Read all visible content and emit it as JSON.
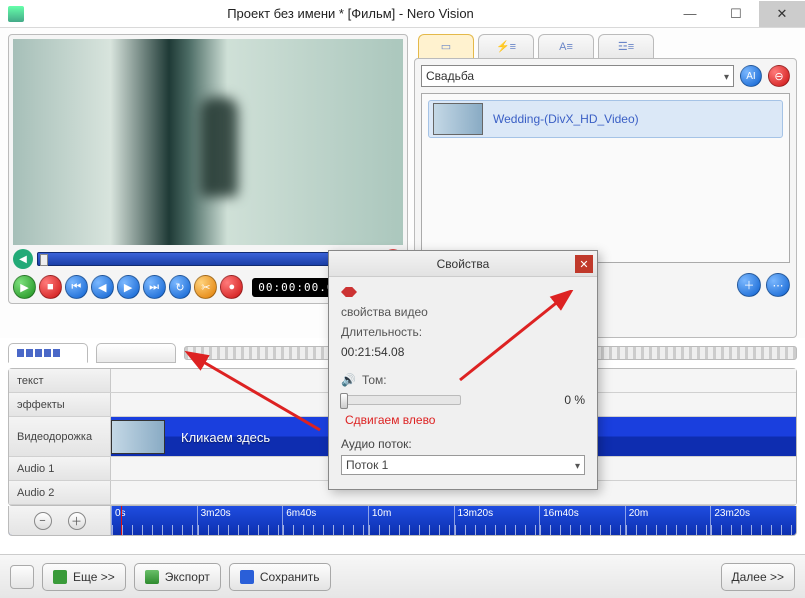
{
  "window": {
    "title": "Проект без имени * [Фильм] - Nero Vision"
  },
  "preview": {
    "timecode": "00:00:00.00"
  },
  "library": {
    "category": "Свадьба",
    "item_name": "Wedding-(DivX_HD_Video)"
  },
  "timeline": {
    "tracks": {
      "text": "текст",
      "effects": "эффекты",
      "video": "Видеодорожка",
      "audio1": "Audio 1",
      "audio2": "Audio 2"
    },
    "clip_label": "Кликаем здесь",
    "ticks": [
      "0s",
      "3m20s",
      "6m40s",
      "10m",
      "13m20s",
      "16m40s",
      "20m",
      "23m20s"
    ]
  },
  "bottom": {
    "more": "Еще >>",
    "export": "Экспорт",
    "save": "Сохранить",
    "next": "Далее >>"
  },
  "props": {
    "title": "Свойства",
    "section": "свойства видео",
    "duration_label": "Длительность:",
    "duration_value": "00:21:54.08",
    "volume_label": "Том:",
    "volume_value": "0 %",
    "shift_text": "Сдвигаем влево",
    "stream_label": "Аудио поток:",
    "stream_value": "Поток 1"
  }
}
